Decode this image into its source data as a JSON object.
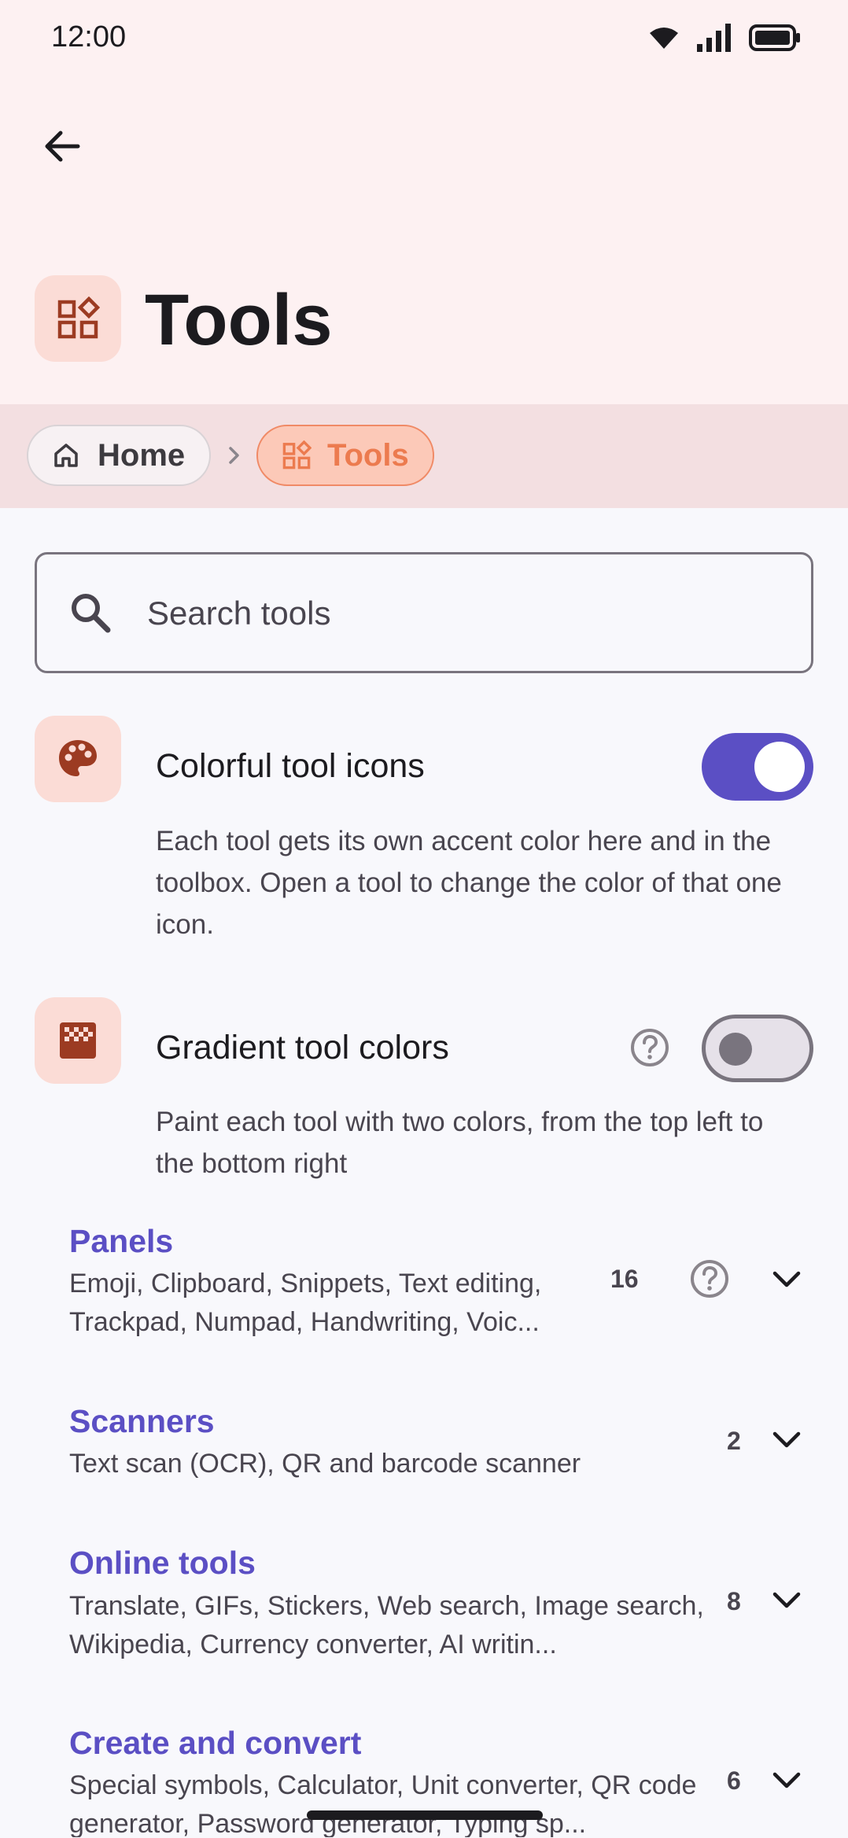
{
  "status_bar": {
    "time": "12:00"
  },
  "header": {
    "title": "Tools"
  },
  "breadcrumb": {
    "home_label": "Home",
    "current_label": "Tools"
  },
  "search": {
    "placeholder": "Search tools",
    "value": ""
  },
  "settings": [
    {
      "title": "Colorful tool icons",
      "description": "Each tool gets its own accent color here and in the toolbox. Open a tool to change the color of that one icon.",
      "enabled": true,
      "icon": "palette-icon"
    },
    {
      "title": "Gradient tool colors",
      "description": "Paint each tool with two colors, from the top left to the bottom right",
      "enabled": false,
      "icon": "gradient-icon"
    }
  ],
  "categories": [
    {
      "title": "Panels",
      "description": "Emoji, Clipboard, Snippets, Text editing, Trackpad, Numpad, Handwriting, Voic...",
      "count": "16",
      "has_help": true
    },
    {
      "title": "Scanners",
      "description": "Text scan (OCR), QR and barcode scanner",
      "count": "2",
      "has_help": false
    },
    {
      "title": "Online tools",
      "description": "Translate, GIFs, Stickers, Web search, Image search, Wikipedia, Currency converter, AI writin...",
      "count": "8",
      "has_help": false
    },
    {
      "title": "Create and convert",
      "description": "Special symbols, Calculator, Unit converter, QR code generator, Password generator, Typing sp...",
      "count": "6",
      "has_help": false
    }
  ],
  "colors": {
    "accent": "#5b4fc4",
    "tool_orange": "#ec7b4f",
    "icon_box": "#fbdcd6",
    "icon_brown": "#9c3b22"
  }
}
